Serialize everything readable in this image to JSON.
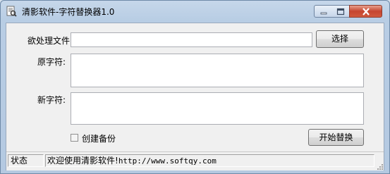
{
  "window": {
    "title": "清影软件-字符替换器1.0"
  },
  "form": {
    "file_label": "欲处理文件:",
    "file_value": "",
    "select_button": "选择",
    "original_label": "原字符:",
    "original_value": "",
    "new_label": "新字符:",
    "new_value": "",
    "backup_checkbox_label": "创建备份",
    "backup_checked": false,
    "start_button": "开始替换"
  },
  "status": {
    "label": "状态",
    "message_prefix": "欢迎使用清影软件!",
    "message_url": "http://www.softqy.com"
  }
}
